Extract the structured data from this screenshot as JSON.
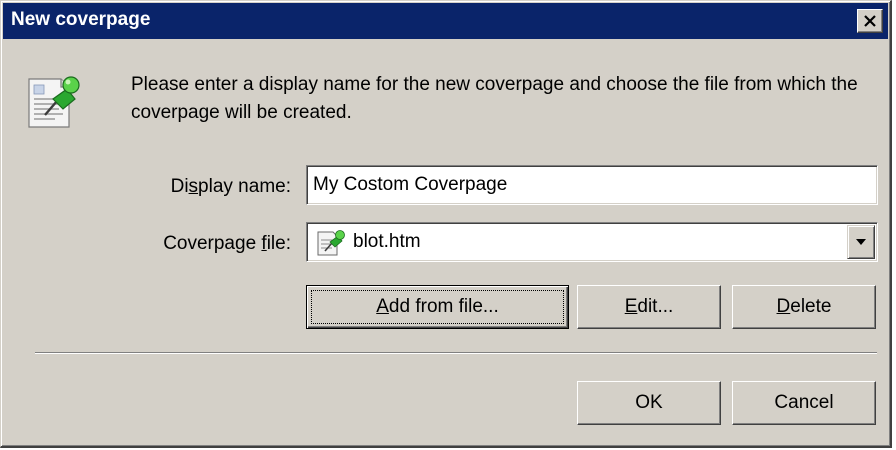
{
  "dialog": {
    "title": "New coverpage",
    "prompt": "Please enter a display name for the new coverpage and choose the file from which the coverpage will be created."
  },
  "form": {
    "display_name": {
      "label_pre": "Di",
      "label_accel": "s",
      "label_post": "play name:",
      "value": "My Costom Coverpage"
    },
    "coverpage_file": {
      "label_pre": "Coverpage ",
      "label_accel": "f",
      "label_post": "ile:",
      "value": "blot.htm",
      "icon": "coverpage-document-icon"
    }
  },
  "buttons": {
    "add_from_file": {
      "accel": "A",
      "rest": "dd from file..."
    },
    "edit": {
      "accel": "E",
      "rest": "dit..."
    },
    "delete": {
      "accel": "D",
      "rest": "elete"
    },
    "ok": "OK",
    "cancel": "Cancel"
  },
  "colors": {
    "titlebar": "#0a246a",
    "face": "#d4d0c8"
  }
}
